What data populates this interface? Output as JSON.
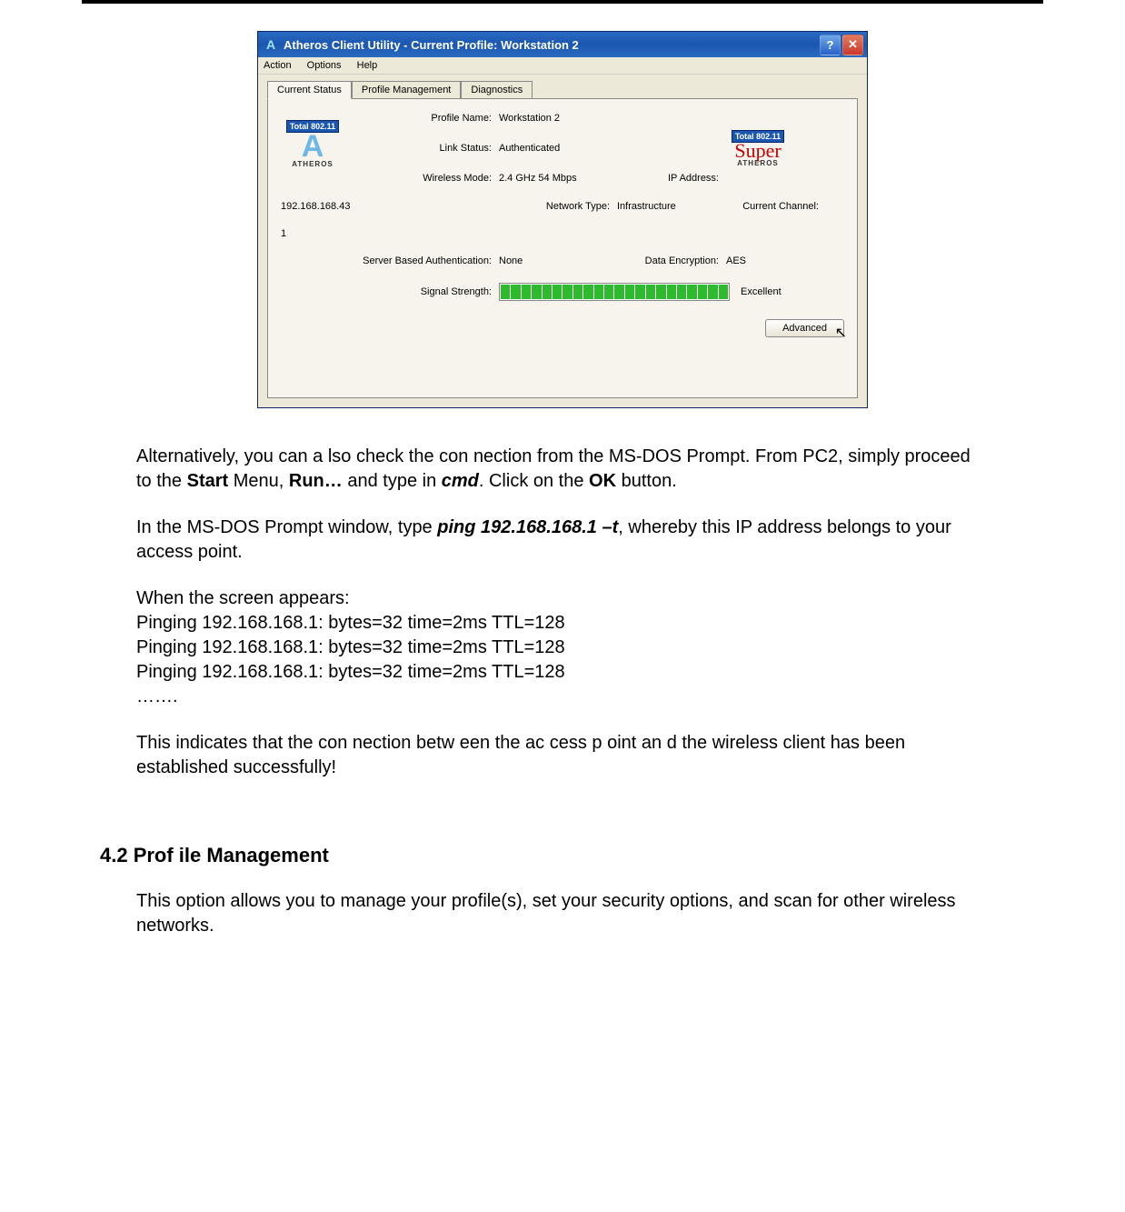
{
  "window": {
    "title": "Atheros Client Utility - Current Profile: Workstation 2",
    "app_icon_letter": "A",
    "help_glyph": "?",
    "close_glyph": "✕",
    "menu": {
      "action": "Action",
      "options": "Options",
      "help": "Help"
    },
    "tabs": {
      "current_status": "Current Status",
      "profile_mgmt": "Profile Management",
      "diagnostics": "Diagnostics"
    },
    "logo": {
      "total": "Total 802.11",
      "letter": "A",
      "brand": "ATHEROS",
      "superg": "Super"
    },
    "labels": {
      "profile_name": "Profile Name:",
      "link_status": "Link Status:",
      "wireless_mode": "Wireless Mode:",
      "network_type": "Network Type:",
      "sba": "Server Based Authentication:",
      "signal": "Signal Strength:",
      "ip": "IP Address:",
      "channel": "Current Channel:",
      "encryption": "Data Encryption:"
    },
    "values": {
      "profile_name": "Workstation 2",
      "link_status": "Authenticated",
      "wireless_mode": "2.4 GHz 54 Mbps",
      "network_type": "Infrastructure",
      "sba": "None",
      "ip": "192.168.168.43",
      "channel": "1",
      "encryption": "AES",
      "signal_text": "Excellent"
    },
    "advanced_btn": "Advanced"
  },
  "doc": {
    "p1a": "Alternatively, you can a    lso check    the con nection from the MS-DOS Prompt. From PC2, simply proceed to the ",
    "p1_start": "Start",
    "p1b": " Menu, ",
    "p1_run": "Run…",
    "p1c": " and type in ",
    "p1_cmd": "cmd",
    "p1d": ". Click on the ",
    "p1_ok": "OK",
    "p1e": " button.",
    "p2a": "In the MS-DOS Prompt window, type ",
    "p2_cmd": "ping 192.168.168.1 –t",
    "p2b": ", whereby this IP address belongs to your access point.",
    "p3_intro": "When the screen appears:",
    "p3_l1": "Pinging 192.168.168.1: bytes=32 time=2ms TTL=128",
    "p3_l2": "Pinging 192.168.168.1: bytes=32 time=2ms TTL=128",
    "p3_l3": "Pinging 192.168.168.1: bytes=32 time=2ms TTL=128",
    "p3_dots": "…….",
    "p4": "This indicates  that the con   nection betw een the ac  cess p oint an d the wireless client has been established successfully!",
    "section_head": "4.2 Prof    ile Management",
    "p5": "This option allows you to manage your profile(s), set your security options, and scan for other wireless networks."
  }
}
